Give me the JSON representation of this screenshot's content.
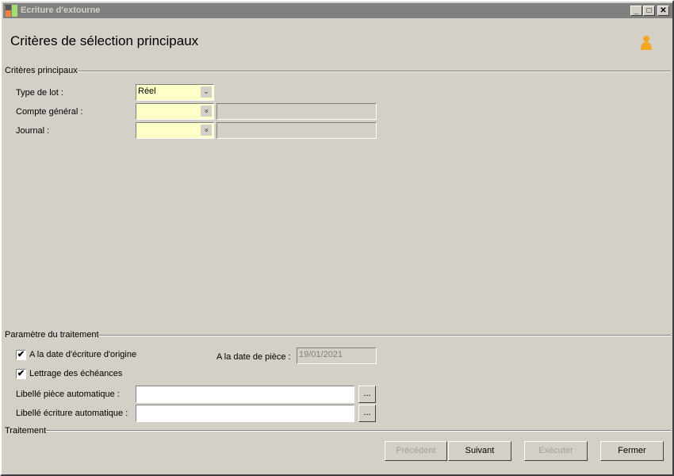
{
  "window": {
    "title": "Ecriture d'extourne",
    "minimize": "_",
    "maximize": "□",
    "close": "✕"
  },
  "heading": "Critères de sélection principaux",
  "main_criteria": {
    "section_label": "Critères principaux",
    "lot_type": {
      "label": "Type de lot :",
      "value": "Réel"
    },
    "general_account": {
      "label": "Compte général :",
      "value": "",
      "description": ""
    },
    "journal": {
      "label": "Journal :",
      "value": "",
      "description": ""
    }
  },
  "processing_params": {
    "section_label": "Paramètre du traitement",
    "origin_date": {
      "label": "A la date d'écriture d'origine",
      "checked": true
    },
    "lettering": {
      "label": "Lettrage des échéances",
      "checked": true
    },
    "piece_date": {
      "label": "A la date de pièce :",
      "value": "19/01/2021"
    },
    "auto_piece_label": {
      "label": "Libellé pièce automatique :",
      "value": ""
    },
    "auto_entry_label": {
      "label": "Libellé écriture automatique :",
      "value": ""
    },
    "browse_label": "..."
  },
  "processing": {
    "section_label": "Traitement"
  },
  "buttons": {
    "previous": "Précédent",
    "next": "Suivant",
    "execute": "Exécuter",
    "close": "Fermer"
  },
  "icons": {
    "check": "✔",
    "combo_arrow": "⌄",
    "combo_double_arrow": "»"
  }
}
